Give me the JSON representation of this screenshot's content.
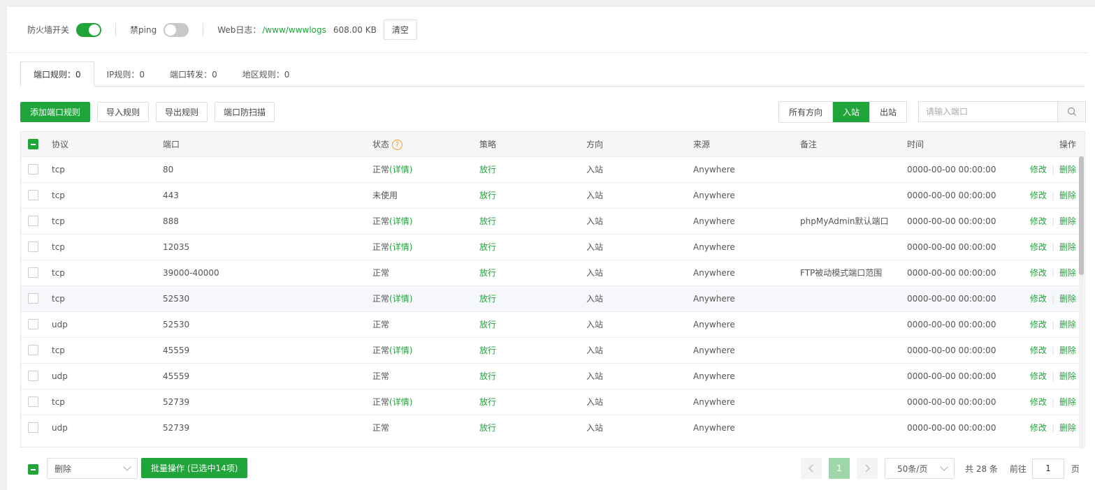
{
  "topbar": {
    "firewall_label": "防火墙开关",
    "firewall_on": true,
    "ping_label": "禁ping",
    "ping_on": false,
    "weblog_label": "Web日志：",
    "weblog_path": "/www/wwwlogs",
    "weblog_size": "608.00 KB",
    "clear_label": "清空"
  },
  "tabs": [
    {
      "label": "端口规则：0",
      "active": true
    },
    {
      "label": "IP规则：0",
      "active": false
    },
    {
      "label": "端口转发：0",
      "active": false
    },
    {
      "label": "地区规则：0",
      "active": false
    }
  ],
  "toolbar": {
    "add_label": "添加端口规则",
    "import_label": "导入规则",
    "export_label": "导出规则",
    "antiscan_label": "端口防扫描",
    "directions": [
      {
        "label": "所有方向",
        "active": false
      },
      {
        "label": "入站",
        "active": true
      },
      {
        "label": "出站",
        "active": false
      }
    ],
    "search_placeholder": "请输入端口"
  },
  "table": {
    "headers": {
      "protocol": "协议",
      "port": "端口",
      "status": "状态",
      "policy": "策略",
      "direction": "方向",
      "source": "来源",
      "note": "备注",
      "time": "时间",
      "ops": "操作"
    },
    "help_glyph": "?",
    "detail_label": "(详情)",
    "edit_label": "修改",
    "delete_label": "删除",
    "rows": [
      {
        "protocol": "tcp",
        "port": "80",
        "status": "正常",
        "detail": true,
        "policy": "放行",
        "direction": "入站",
        "source": "Anywhere",
        "note": "",
        "time": "0000-00-00 00:00:00"
      },
      {
        "protocol": "tcp",
        "port": "443",
        "status": "未使用",
        "detail": false,
        "policy": "放行",
        "direction": "入站",
        "source": "Anywhere",
        "note": "",
        "time": "0000-00-00 00:00:00"
      },
      {
        "protocol": "tcp",
        "port": "888",
        "status": "正常",
        "detail": true,
        "policy": "放行",
        "direction": "入站",
        "source": "Anywhere",
        "note": "phpMyAdmin默认端口",
        "time": "0000-00-00 00:00:00"
      },
      {
        "protocol": "tcp",
        "port": "12035",
        "status": "正常",
        "detail": true,
        "policy": "放行",
        "direction": "入站",
        "source": "Anywhere",
        "note": "",
        "time": "0000-00-00 00:00:00"
      },
      {
        "protocol": "tcp",
        "port": "39000-40000",
        "status": "正常",
        "detail": false,
        "policy": "放行",
        "direction": "入站",
        "source": "Anywhere",
        "note": "FTP被动模式端口范围",
        "time": "0000-00-00 00:00:00"
      },
      {
        "protocol": "tcp",
        "port": "52530",
        "status": "正常",
        "detail": true,
        "policy": "放行",
        "direction": "入站",
        "source": "Anywhere",
        "note": "",
        "time": "0000-00-00 00:00:00",
        "hover": true
      },
      {
        "protocol": "udp",
        "port": "52530",
        "status": "正常",
        "detail": false,
        "policy": "放行",
        "direction": "入站",
        "source": "Anywhere",
        "note": "",
        "time": "0000-00-00 00:00:00"
      },
      {
        "protocol": "tcp",
        "port": "45559",
        "status": "正常",
        "detail": true,
        "policy": "放行",
        "direction": "入站",
        "source": "Anywhere",
        "note": "",
        "time": "0000-00-00 00:00:00"
      },
      {
        "protocol": "udp",
        "port": "45559",
        "status": "正常",
        "detail": false,
        "policy": "放行",
        "direction": "入站",
        "source": "Anywhere",
        "note": "",
        "time": "0000-00-00 00:00:00"
      },
      {
        "protocol": "tcp",
        "port": "52739",
        "status": "正常",
        "detail": true,
        "policy": "放行",
        "direction": "入站",
        "source": "Anywhere",
        "note": "",
        "time": "0000-00-00 00:00:00"
      },
      {
        "protocol": "udp",
        "port": "52739",
        "status": "正常",
        "detail": false,
        "policy": "放行",
        "direction": "入站",
        "source": "Anywhere",
        "note": "",
        "time": "0000-00-00 00:00:00"
      }
    ]
  },
  "footer": {
    "batch_select_value": "删除",
    "batch_button_label": "批量操作 (已选中14项)",
    "current_page": "1",
    "page_size_label": "50条/页",
    "total_label": "共 28 条",
    "goto_label": "前往",
    "goto_value": "1",
    "page_unit": "页"
  },
  "colors": {
    "accent": "#20a53a"
  }
}
